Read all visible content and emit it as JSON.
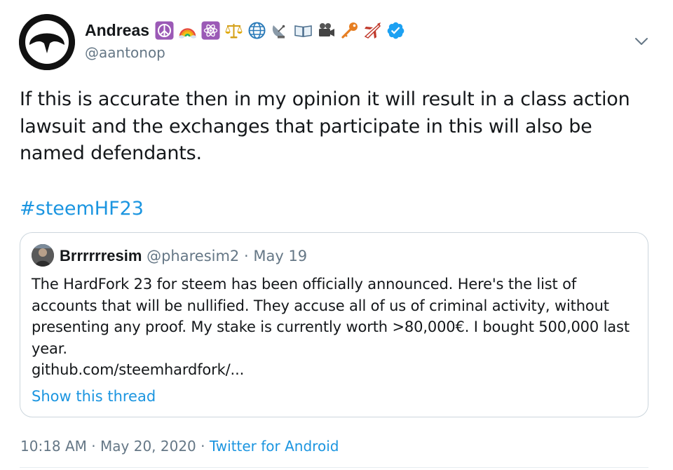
{
  "author": {
    "display_name": "Andreas",
    "handle": "@aantonop",
    "name_emojis": [
      "peace-symbol-icon",
      "rainbow-icon",
      "atom-icon",
      "balance-scale-icon",
      "globe-icon",
      "satellite-dish-icon",
      "open-book-icon",
      "movie-camera-icon",
      "key-icon",
      "airplane-icon"
    ],
    "verified": true
  },
  "tweet": {
    "text": "If this is accurate then in my opinion it will result in a class action lawsuit and the exchanges that participate in this will also be named defendants.",
    "hashtag": "#steemHF23"
  },
  "quoted": {
    "display_name": "Brrrrrresim",
    "handle": "@pharesim2",
    "separator": "·",
    "date": "May 19",
    "text_lines": [
      "The HardFork 23 for steem has been officially announced. Here's the list of",
      "accounts that will be nullified. They accuse all of us of criminal activity, without",
      "presenting any proof. My stake is currently worth >80,000€. I bought 500,000 last",
      "year.",
      "github.com/steemhardfork/..."
    ],
    "show_thread": "Show this thread"
  },
  "meta": {
    "time": "10:18 AM",
    "sep1": "·",
    "date": "May 20, 2020",
    "sep2": "·",
    "source": "Twitter for Android"
  },
  "colors": {
    "link": "#1b95e0",
    "secondary_text": "#657786",
    "border": "#ccd6dd",
    "verified": "#1da1f2"
  }
}
